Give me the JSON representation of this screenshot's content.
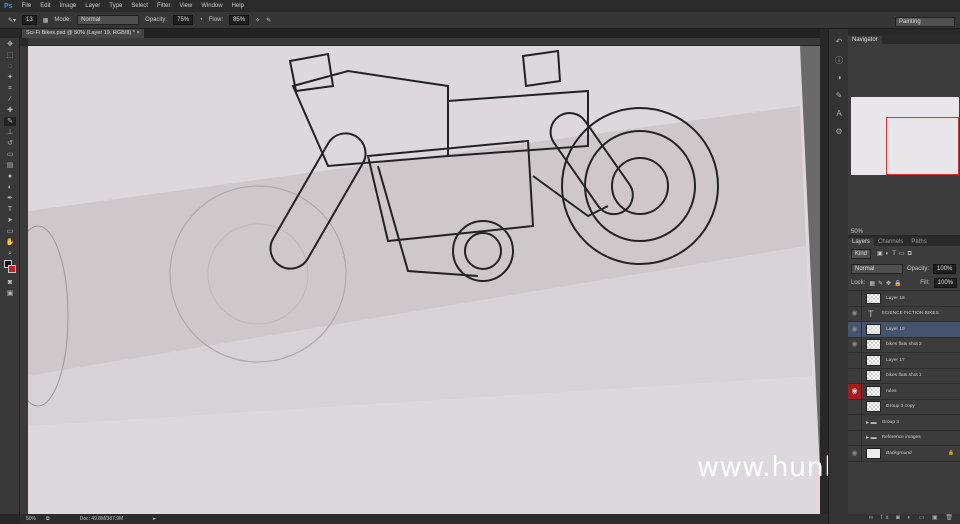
{
  "app": {
    "logo": "Ps"
  },
  "menu": [
    "File",
    "Edit",
    "Image",
    "Layer",
    "Type",
    "Select",
    "Filter",
    "View",
    "Window",
    "Help"
  ],
  "options": {
    "brush_size": "13",
    "mode_label": "Mode:",
    "mode": "Normal",
    "opacity_label": "Opacity:",
    "opacity": "75%",
    "flow_label": "Flow:",
    "flow": "85%"
  },
  "workspace": "Painting",
  "document_tab": "Sci-Fi Bikes.psd @ 50% (Layer 19, RGB/8) *",
  "status": {
    "zoom": "50%",
    "doc": "Doc: 49.8M/387.9M"
  },
  "navigator": {
    "tab": "Navigator",
    "zoom": "50%"
  },
  "layers_panel": {
    "tabs": [
      "Layers",
      "Channels",
      "Paths"
    ],
    "filter": "Kind",
    "blend": "Normal",
    "opacity_label": "Opacity:",
    "opacity": "100%",
    "lock_label": "Lock:",
    "fill_label": "Fill:",
    "fill": "100%",
    "layers": [
      {
        "name": "Layer 18",
        "type": "pixel",
        "visible": false,
        "selected": false
      },
      {
        "name": "SCIENCE FICTION BIKES",
        "type": "text",
        "visible": true,
        "selected": false
      },
      {
        "name": "Layer 19",
        "type": "pixel",
        "visible": true,
        "selected": true
      },
      {
        "name": "bikes flats shot 2",
        "type": "smart",
        "visible": true,
        "selected": false
      },
      {
        "name": "Layer 17",
        "type": "pixel",
        "visible": false,
        "selected": false
      },
      {
        "name": "bikes flats shot 1",
        "type": "smart",
        "visible": false,
        "selected": false
      },
      {
        "name": "rules",
        "type": "pixel",
        "visible": true,
        "selected": false,
        "highlight": "#a51c1c"
      },
      {
        "name": "Group 3 copy",
        "type": "pixel",
        "visible": false,
        "selected": false
      },
      {
        "name": "Group 3",
        "type": "group",
        "visible": false,
        "selected": false
      },
      {
        "name": "Reference images",
        "type": "group",
        "visible": false,
        "selected": false
      },
      {
        "name": "Background",
        "type": "background",
        "visible": true,
        "selected": false
      }
    ]
  },
  "watermark": "www.hunls.com",
  "colors": {
    "foreground": "#111111",
    "background": "#c81e1e",
    "canvas": "#dcd8dc"
  }
}
